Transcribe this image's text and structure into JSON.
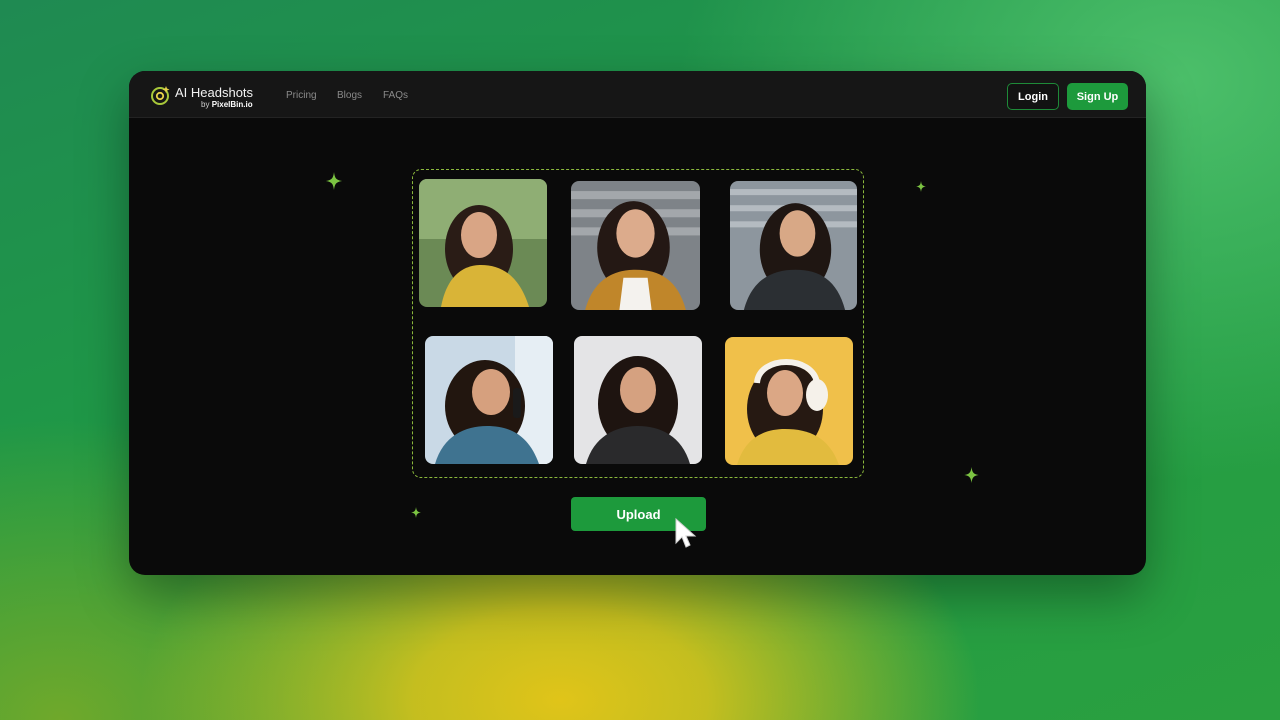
{
  "app": {
    "title": "AI Headshots",
    "subtitle_prefix": "by",
    "subtitle_brand": "PixelBin.io"
  },
  "nav": {
    "links": [
      "Pricing",
      "Blogs",
      "FAQs"
    ]
  },
  "auth": {
    "login_label": "Login",
    "signup_label": "Sign Up"
  },
  "upload": {
    "button_label": "Upload"
  },
  "photos": [
    {
      "name": "headshot-park-yellow-top",
      "bg": "#5f7f4a",
      "clothes": "#d9b437"
    },
    {
      "name": "headshot-striped-wall-jacket",
      "bg": "#8c8f92",
      "clothes": "#c0862a"
    },
    {
      "name": "headshot-striped-wall-leather",
      "bg": "#8d969e",
      "clothes": "#2b2f33"
    },
    {
      "name": "headshot-phone-call",
      "bg": "#c9d9e6",
      "clothes": "#3f7390"
    },
    {
      "name": "headshot-white-bg-leather",
      "bg": "#e4e4e6",
      "clothes": "#2a2a2c"
    },
    {
      "name": "headshot-headphones-yellow",
      "bg": "#f0c04a",
      "clothes": "#e2bb3e"
    }
  ],
  "colors": {
    "accent": "#1d9a3c",
    "dashed_border": "#8ab83c",
    "sparkle": "#7cc442",
    "window_bg": "#0a0a0a",
    "navbar_bg": "#161616"
  },
  "icons": {
    "logo": "camera-sparkle-icon",
    "sparkle": "four-point-star-icon",
    "cursor": "mouse-pointer-icon"
  }
}
